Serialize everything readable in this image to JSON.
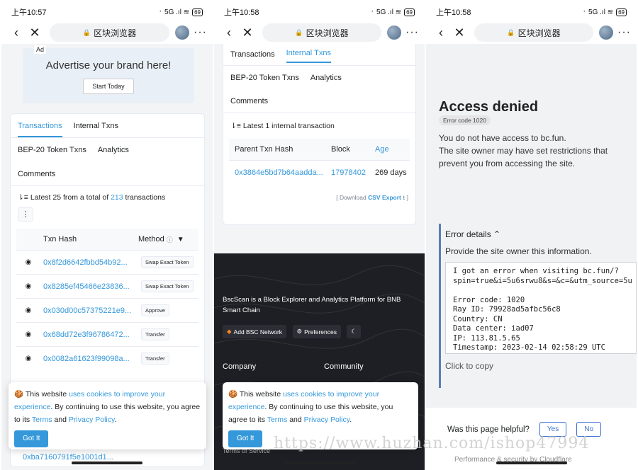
{
  "status": {
    "time1": "上午10:57",
    "time2": "上午10:58",
    "time3": "上午10:58",
    "signal": "᛫ 5G .ıl ≋",
    "battery": "69"
  },
  "address": {
    "title": "区块浏览器",
    "lock": "🔒"
  },
  "panel1": {
    "ad_tag": "Ad",
    "ad_text": "Advertise your brand here!",
    "ad_button": "Start Today",
    "tabs": [
      "Transactions",
      "Internal Txns",
      "BEP-20 Token Txns",
      "Analytics",
      "Comments"
    ],
    "summary_prefix": "Latest 25 from a total of",
    "summary_count": "213",
    "summary_suffix": "transactions",
    "col_hash": "Txn Hash",
    "col_method": "Method",
    "rows": [
      {
        "hash": "0x8f2d6642fbbd54b92...",
        "method": "Swap Exact Token"
      },
      {
        "hash": "0x8285ef45466e23836...",
        "method": "Swap Exact Token"
      },
      {
        "hash": "0x030d00c57375221e9...",
        "method": "Approve"
      },
      {
        "hash": "0x68dd72e3f96786472...",
        "method": "Transfer"
      },
      {
        "hash": "0x0082a61623f99098a...",
        "method": "Transfer"
      }
    ],
    "partial_row": "0xba7160791f5e1001d1..."
  },
  "cookie": {
    "p1": "This website",
    "link1": "uses cookies to improve your experience",
    "p2": ". By continuing to use this website, you agree to its",
    "terms": "Terms",
    "and": "and",
    "privacy": "Privacy Policy",
    "button": "Got It"
  },
  "panel2": {
    "tabs": [
      "Transactions",
      "Internal Txns",
      "BEP-20 Token Txns",
      "Analytics",
      "Comments"
    ],
    "summary": "Latest 1 internal transaction",
    "col_parent": "Parent Txn Hash",
    "col_block": "Block",
    "col_age": "Age",
    "row_hash": "0x3864e5bd7b64aadda...",
    "row_block": "17978402",
    "row_age": "269 days",
    "download": "[ Download",
    "csv": "CSV Export",
    "download_end": "]",
    "footer_text": "BscScan is a Block Explorer and Analytics Platform for BNB Smart Chain",
    "btn_add": "Add BSC Network",
    "btn_pref": "Preferences",
    "company": "Company",
    "community": "Community",
    "terms_service": "Terms of Service"
  },
  "panel3": {
    "title": "Access denied",
    "error_code_badge": "Error code 1020",
    "line1": "You do not have access to bc.fun.",
    "line2": "The site owner may have set restrictions that prevent you from accessing the site.",
    "details_title": "Error details",
    "details_sub": "Provide the site owner this information.",
    "details_text": "I got an error when visiting bc.fun/?\nspin=true&i=5u6srwu8&s=&c=&utm_source=5u\n\nError code: 1020\nRay ID: 79928ad5afbc56c8\nCountry: CN\nData center: iad07\nIP: 113.81.5.65\nTimestamp: 2023-02-14 02:58:29 UTC",
    "click_copy": "Click to copy",
    "helpful": "Was this page helpful?",
    "yes": "Yes",
    "no": "No",
    "bottom_partial": "Performance & security by Cloudflare"
  },
  "watermark": "https://www.huzhan.com/ishop47994"
}
